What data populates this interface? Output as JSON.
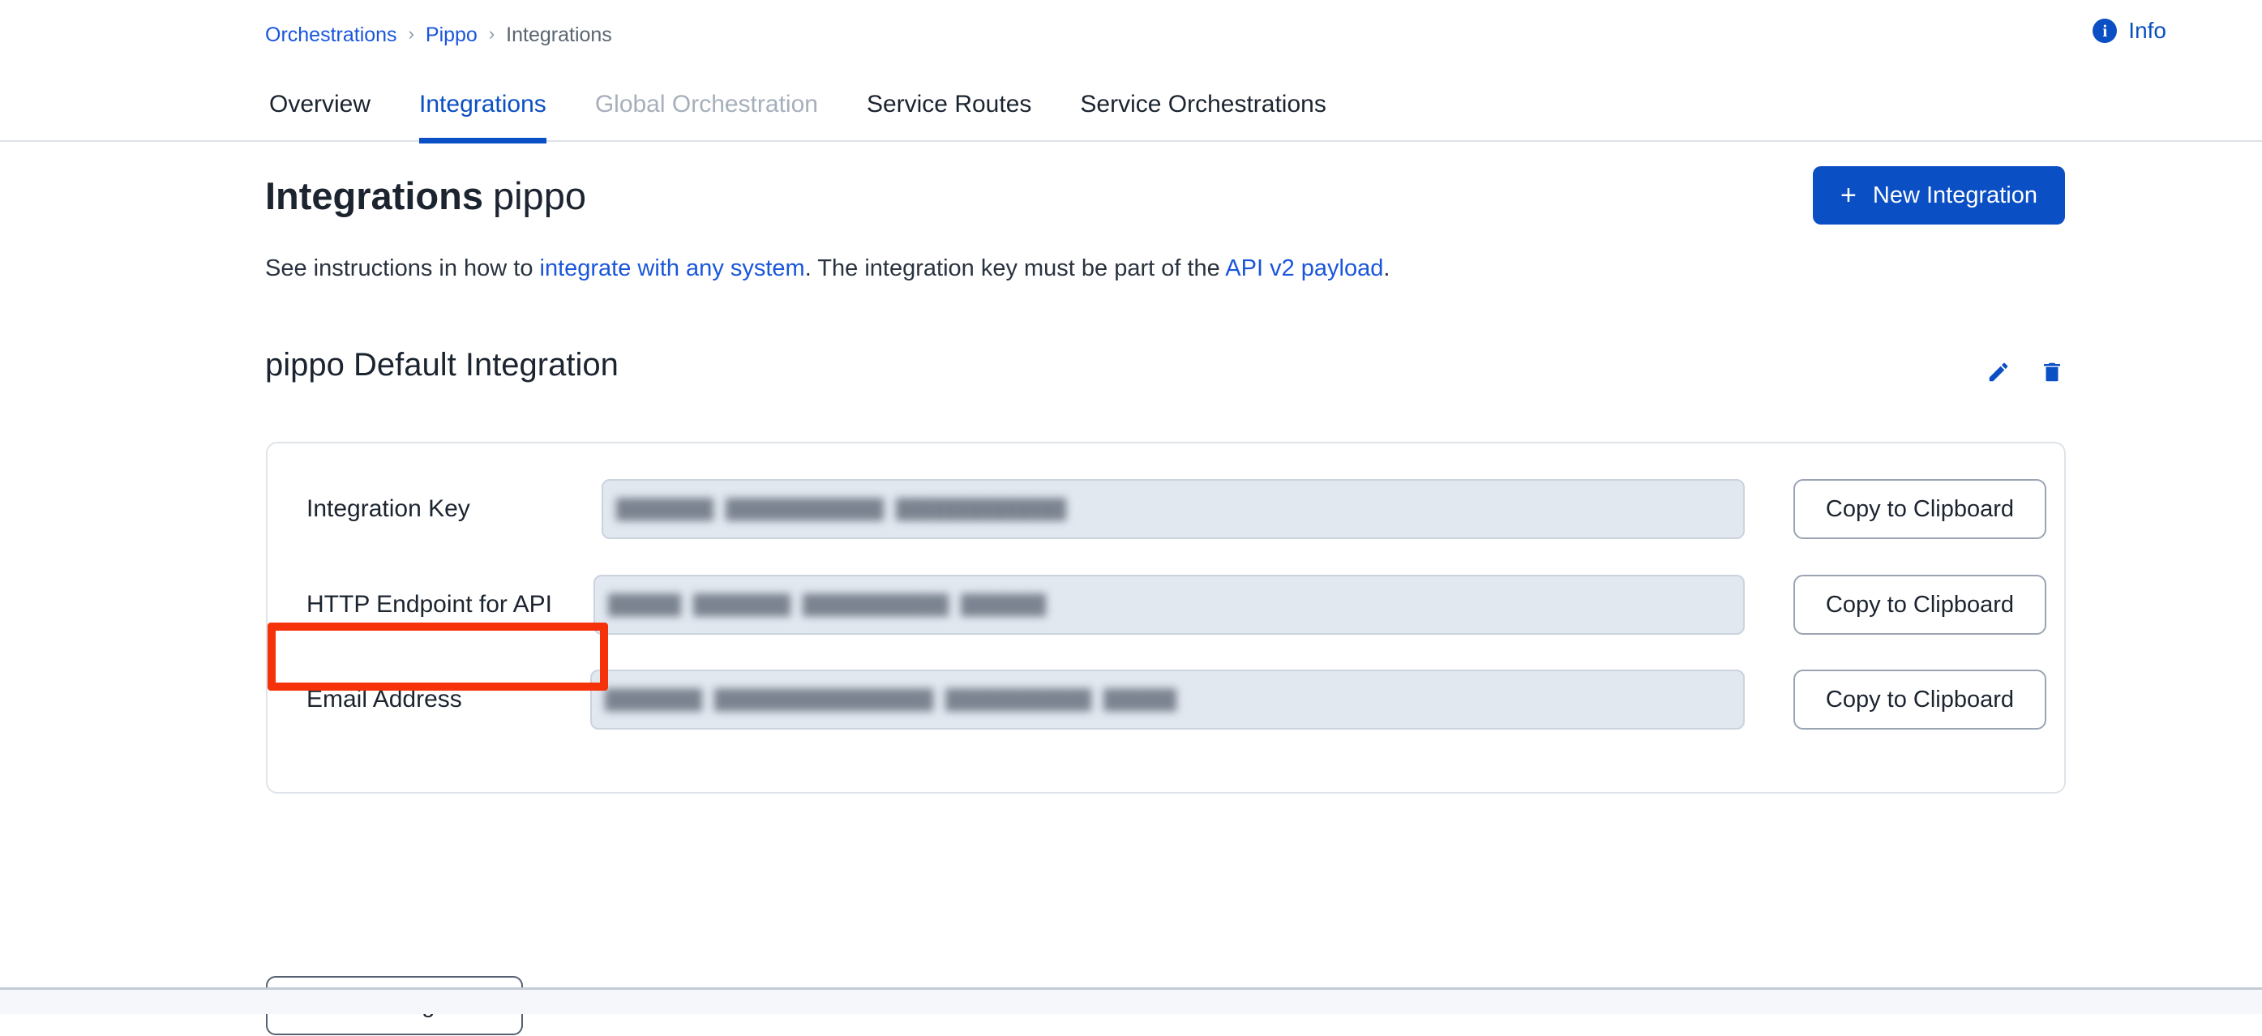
{
  "breadcrumb": {
    "items": [
      {
        "label": "Orchestrations",
        "type": "link"
      },
      {
        "label": "Pippo",
        "type": "link"
      },
      {
        "label": "Integrations",
        "type": "current"
      }
    ],
    "separator": "›"
  },
  "header": {
    "info_label": "Info",
    "info_icon": "info-circle-icon"
  },
  "tabs": [
    {
      "label": "Overview",
      "state": "default"
    },
    {
      "label": "Integrations",
      "state": "active"
    },
    {
      "label": "Global Orchestration",
      "state": "disabled"
    },
    {
      "label": "Service Routes",
      "state": "default"
    },
    {
      "label": "Service Orchestrations",
      "state": "default"
    }
  ],
  "main": {
    "title_strong": "Integrations",
    "title_light": "pippo",
    "new_integration_label": "New Integration",
    "plus_glyph": "+",
    "instructions": {
      "part1": "See instructions in how to ",
      "link1": "integrate with any system",
      "part2": ". The integration key must be part of the ",
      "link2": "API v2 payload",
      "part3": "."
    },
    "section_title": "pippo Default Integration",
    "edit_icon": "pencil-edit-icon",
    "delete_icon": "trash-delete-icon",
    "fields": [
      {
        "label": "Integration Key",
        "value": "████████ █████████████ ██████████████",
        "redacted": true,
        "copy_label": "Copy to Clipboard",
        "highlighted": true
      },
      {
        "label": "HTTP Endpoint for API",
        "value": "██████ ████████ ████████████ ███████",
        "redacted": true,
        "copy_label": "Copy to Clipboard",
        "highlighted": false
      },
      {
        "label": "Email Address",
        "value": "████████ ██████████████████ ████████████ ██████",
        "redacted": true,
        "copy_label": "Copy to Clipboard",
        "highlighted": false
      }
    ],
    "new_integration_secondary_label": "New Integration"
  },
  "annotation": {
    "highlight_color": "#f5320a",
    "target": "Integration Key"
  },
  "colors": {
    "brand_blue": "#0b4fc4",
    "link_blue": "#1a56db",
    "text_dark": "#1c2430",
    "muted": "#a6afbb",
    "field_bg": "#e2e8f0"
  }
}
